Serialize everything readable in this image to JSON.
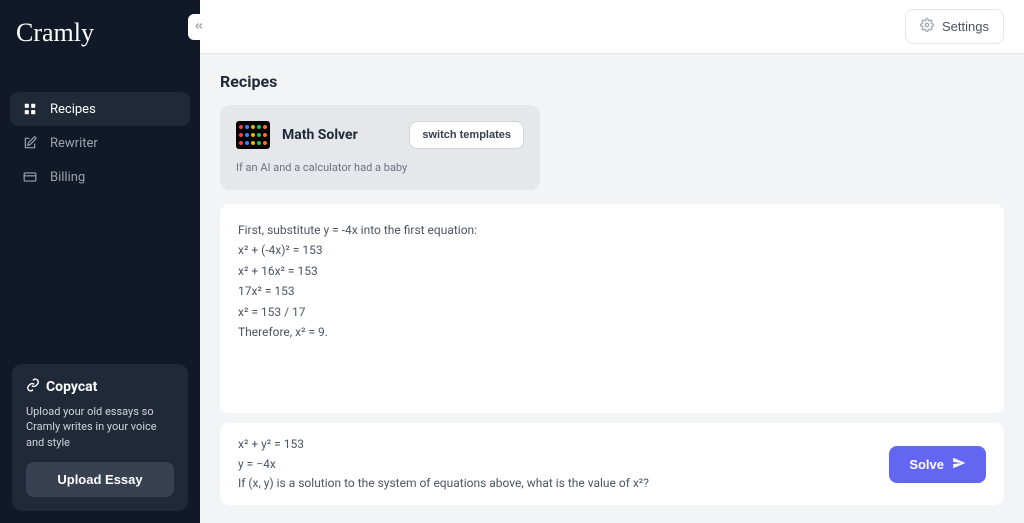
{
  "brand": "Cramly",
  "sidebar": {
    "items": [
      {
        "label": "Recipes"
      },
      {
        "label": "Rewriter"
      },
      {
        "label": "Billing"
      }
    ]
  },
  "header": {
    "settings_label": "Settings"
  },
  "page": {
    "title": "Recipes"
  },
  "recipe": {
    "name": "Math Solver",
    "tagline": "If an AI and a calculator had a baby",
    "switch_label": "switch templates"
  },
  "output": {
    "lines": [
      "First, substitute y = -4x into the first equation:",
      "",
      "x² + (-4x)² = 153",
      "x² + 16x² = 153",
      "17x² = 153",
      "x² = 153 / 17",
      "Therefore, x² = 9."
    ]
  },
  "input": {
    "lines": [
      "x² + y² = 153",
      "y = −4x",
      "If (x, y) is a solution to the system of equations above, what is the value of x²?"
    ]
  },
  "solve": {
    "label": "Solve"
  },
  "promo": {
    "title": "Copycat",
    "desc": "Upload your old essays so Cramly writes in your voice and style",
    "button": "Upload Essay"
  }
}
